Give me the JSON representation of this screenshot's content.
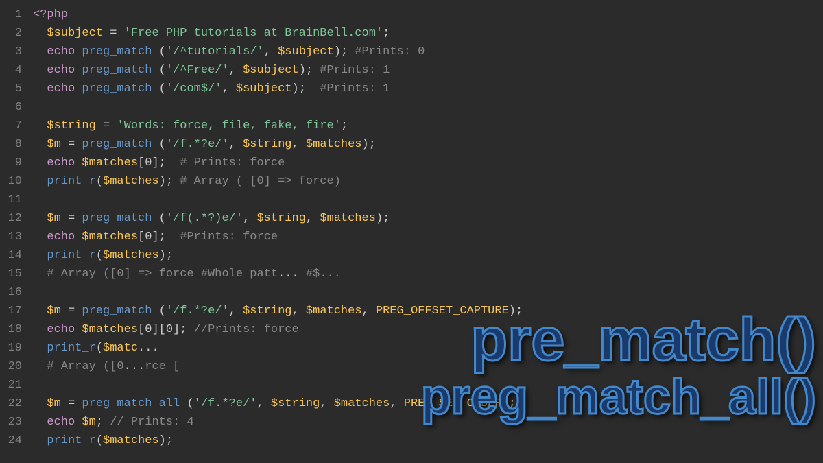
{
  "code": {
    "lines": [
      {
        "num": 1,
        "tokens": [
          {
            "t": "php-tag",
            "v": "<?php"
          }
        ]
      },
      {
        "num": 2,
        "tokens": [
          {
            "t": "plain",
            "v": "  "
          },
          {
            "t": "var",
            "v": "$subject"
          },
          {
            "t": "plain",
            "v": " = "
          },
          {
            "t": "str",
            "v": "'Free PHP tutorials at BrainBell.com'"
          },
          {
            "t": "plain",
            "v": ";"
          }
        ]
      },
      {
        "num": 3,
        "tokens": [
          {
            "t": "plain",
            "v": "  "
          },
          {
            "t": "kw",
            "v": "echo"
          },
          {
            "t": "plain",
            "v": " "
          },
          {
            "t": "fn",
            "v": "preg_match"
          },
          {
            "t": "plain",
            "v": " ("
          },
          {
            "t": "str",
            "v": "'/^tutorials/'"
          },
          {
            "t": "plain",
            "v": ", "
          },
          {
            "t": "var",
            "v": "$subject"
          },
          {
            "t": "plain",
            "v": "); "
          },
          {
            "t": "cm",
            "v": "#Prints: 0"
          }
        ]
      },
      {
        "num": 4,
        "tokens": [
          {
            "t": "plain",
            "v": "  "
          },
          {
            "t": "kw",
            "v": "echo"
          },
          {
            "t": "plain",
            "v": " "
          },
          {
            "t": "fn",
            "v": "preg_match"
          },
          {
            "t": "plain",
            "v": " ("
          },
          {
            "t": "str",
            "v": "'/^Free/'"
          },
          {
            "t": "plain",
            "v": ", "
          },
          {
            "t": "var",
            "v": "$subject"
          },
          {
            "t": "plain",
            "v": "); "
          },
          {
            "t": "cm",
            "v": "#Prints: 1"
          }
        ]
      },
      {
        "num": 5,
        "tokens": [
          {
            "t": "plain",
            "v": "  "
          },
          {
            "t": "kw",
            "v": "echo"
          },
          {
            "t": "plain",
            "v": " "
          },
          {
            "t": "fn",
            "v": "preg_match"
          },
          {
            "t": "plain",
            "v": " ("
          },
          {
            "t": "str",
            "v": "'/com$/'"
          },
          {
            "t": "plain",
            "v": ", "
          },
          {
            "t": "var",
            "v": "$subject"
          },
          {
            "t": "plain",
            "v": "); "
          },
          {
            "t": "cm",
            "v": " #Prints: 1"
          }
        ]
      },
      {
        "num": 6,
        "tokens": []
      },
      {
        "num": 7,
        "tokens": [
          {
            "t": "plain",
            "v": "  "
          },
          {
            "t": "var",
            "v": "$string"
          },
          {
            "t": "plain",
            "v": " = "
          },
          {
            "t": "str",
            "v": "'Words: force, file, fake, fire'"
          },
          {
            "t": "plain",
            "v": ";"
          }
        ]
      },
      {
        "num": 8,
        "tokens": [
          {
            "t": "plain",
            "v": "  "
          },
          {
            "t": "var",
            "v": "$m"
          },
          {
            "t": "plain",
            "v": " = "
          },
          {
            "t": "fn",
            "v": "preg_match"
          },
          {
            "t": "plain",
            "v": " ("
          },
          {
            "t": "str",
            "v": "'/f.*?e/'"
          },
          {
            "t": "plain",
            "v": ", "
          },
          {
            "t": "var",
            "v": "$string"
          },
          {
            "t": "plain",
            "v": ", "
          },
          {
            "t": "var",
            "v": "$matches"
          },
          {
            "t": "plain",
            "v": ");"
          }
        ]
      },
      {
        "num": 9,
        "tokens": [
          {
            "t": "plain",
            "v": "  "
          },
          {
            "t": "kw",
            "v": "echo"
          },
          {
            "t": "plain",
            "v": " "
          },
          {
            "t": "var",
            "v": "$matches"
          },
          {
            "t": "plain",
            "v": "[0];  "
          },
          {
            "t": "cm",
            "v": "# Prints: force"
          }
        ]
      },
      {
        "num": 10,
        "tokens": [
          {
            "t": "plain",
            "v": "  "
          },
          {
            "t": "fn",
            "v": "print_r"
          },
          {
            "t": "plain",
            "v": "("
          },
          {
            "t": "var",
            "v": "$matches"
          },
          {
            "t": "plain",
            "v": "); "
          },
          {
            "t": "cm",
            "v": "# Array ( [0] => force)"
          }
        ]
      },
      {
        "num": 11,
        "tokens": []
      },
      {
        "num": 12,
        "tokens": [
          {
            "t": "plain",
            "v": "  "
          },
          {
            "t": "var",
            "v": "$m"
          },
          {
            "t": "plain",
            "v": " = "
          },
          {
            "t": "fn",
            "v": "preg_match"
          },
          {
            "t": "plain",
            "v": " ("
          },
          {
            "t": "str",
            "v": "'/f(.*?)e/'"
          },
          {
            "t": "plain",
            "v": ", "
          },
          {
            "t": "var",
            "v": "$string"
          },
          {
            "t": "plain",
            "v": ", "
          },
          {
            "t": "var",
            "v": "$matches"
          },
          {
            "t": "plain",
            "v": ");"
          }
        ]
      },
      {
        "num": 13,
        "tokens": [
          {
            "t": "plain",
            "v": "  "
          },
          {
            "t": "kw",
            "v": "echo"
          },
          {
            "t": "plain",
            "v": " "
          },
          {
            "t": "var",
            "v": "$matches"
          },
          {
            "t": "plain",
            "v": "[0];  "
          },
          {
            "t": "cm",
            "v": "#Prints: force"
          }
        ]
      },
      {
        "num": 14,
        "tokens": [
          {
            "t": "plain",
            "v": "  "
          },
          {
            "t": "fn",
            "v": "print_r"
          },
          {
            "t": "plain",
            "v": "("
          },
          {
            "t": "var",
            "v": "$matches"
          },
          {
            "t": "plain",
            "v": ");"
          }
        ]
      },
      {
        "num": 15,
        "tokens": [
          {
            "t": "plain",
            "v": "  "
          },
          {
            "t": "cm",
            "v": "# Array ([0] => force #Whole patt"
          },
          {
            "t": "plain",
            "v": "..."
          },
          {
            "t": "cm",
            "v": " #$..."
          }
        ]
      },
      {
        "num": 16,
        "tokens": []
      },
      {
        "num": 17,
        "tokens": [
          {
            "t": "plain",
            "v": "  "
          },
          {
            "t": "var",
            "v": "$m"
          },
          {
            "t": "plain",
            "v": " = "
          },
          {
            "t": "fn",
            "v": "preg_match"
          },
          {
            "t": "plain",
            "v": " ("
          },
          {
            "t": "str",
            "v": "'/f.*?e/'"
          },
          {
            "t": "plain",
            "v": ", "
          },
          {
            "t": "var",
            "v": "$string"
          },
          {
            "t": "plain",
            "v": ", "
          },
          {
            "t": "var",
            "v": "$matches"
          },
          {
            "t": "plain",
            "v": ", "
          },
          {
            "t": "const",
            "v": "PREG_OFFSET_CAPTURE"
          },
          {
            "t": "plain",
            "v": ");"
          }
        ]
      },
      {
        "num": 18,
        "tokens": [
          {
            "t": "plain",
            "v": "  "
          },
          {
            "t": "kw",
            "v": "echo"
          },
          {
            "t": "plain",
            "v": " "
          },
          {
            "t": "var",
            "v": "$matches"
          },
          {
            "t": "plain",
            "v": "[0][0]; "
          },
          {
            "t": "cm",
            "v": "//Prints: force"
          }
        ]
      },
      {
        "num": 19,
        "tokens": [
          {
            "t": "plain",
            "v": "  "
          },
          {
            "t": "fn",
            "v": "print_r"
          },
          {
            "t": "plain",
            "v": "("
          },
          {
            "t": "var",
            "v": "$matc"
          },
          {
            "t": "plain",
            "v": "..."
          }
        ]
      },
      {
        "num": 20,
        "tokens": [
          {
            "t": "plain",
            "v": "  "
          },
          {
            "t": "cm",
            "v": "# Array ([0"
          },
          {
            "t": "plain",
            "v": "..."
          },
          {
            "t": "cm",
            "v": "rce ["
          }
        ]
      },
      {
        "num": 21,
        "tokens": []
      },
      {
        "num": 22,
        "tokens": [
          {
            "t": "plain",
            "v": "  "
          },
          {
            "t": "var",
            "v": "$m"
          },
          {
            "t": "plain",
            "v": " = "
          },
          {
            "t": "fn",
            "v": "preg_match_all"
          },
          {
            "t": "plain",
            "v": " ("
          },
          {
            "t": "str",
            "v": "'/f.*?e/'"
          },
          {
            "t": "plain",
            "v": ", "
          },
          {
            "t": "var",
            "v": "$string"
          },
          {
            "t": "plain",
            "v": ", "
          },
          {
            "t": "var",
            "v": "$matches"
          },
          {
            "t": "plain",
            "v": ", "
          },
          {
            "t": "const",
            "v": "PREG_SET_ORDER"
          },
          {
            "t": "plain",
            "v": ");"
          }
        ]
      },
      {
        "num": 23,
        "tokens": [
          {
            "t": "plain",
            "v": "  "
          },
          {
            "t": "kw",
            "v": "echo"
          },
          {
            "t": "plain",
            "v": " "
          },
          {
            "t": "var",
            "v": "$m"
          },
          {
            "t": "plain",
            "v": "; "
          },
          {
            "t": "cm",
            "v": "// Prints: 4"
          }
        ]
      },
      {
        "num": 24,
        "tokens": [
          {
            "t": "plain",
            "v": "  "
          },
          {
            "t": "fn",
            "v": "print_r"
          },
          {
            "t": "plain",
            "v": "("
          },
          {
            "t": "var",
            "v": "$matches"
          },
          {
            "t": "plain",
            "v": ");"
          }
        ]
      }
    ]
  },
  "overlay": {
    "line1": "pre_match()",
    "line2": "preg_match_all()"
  }
}
